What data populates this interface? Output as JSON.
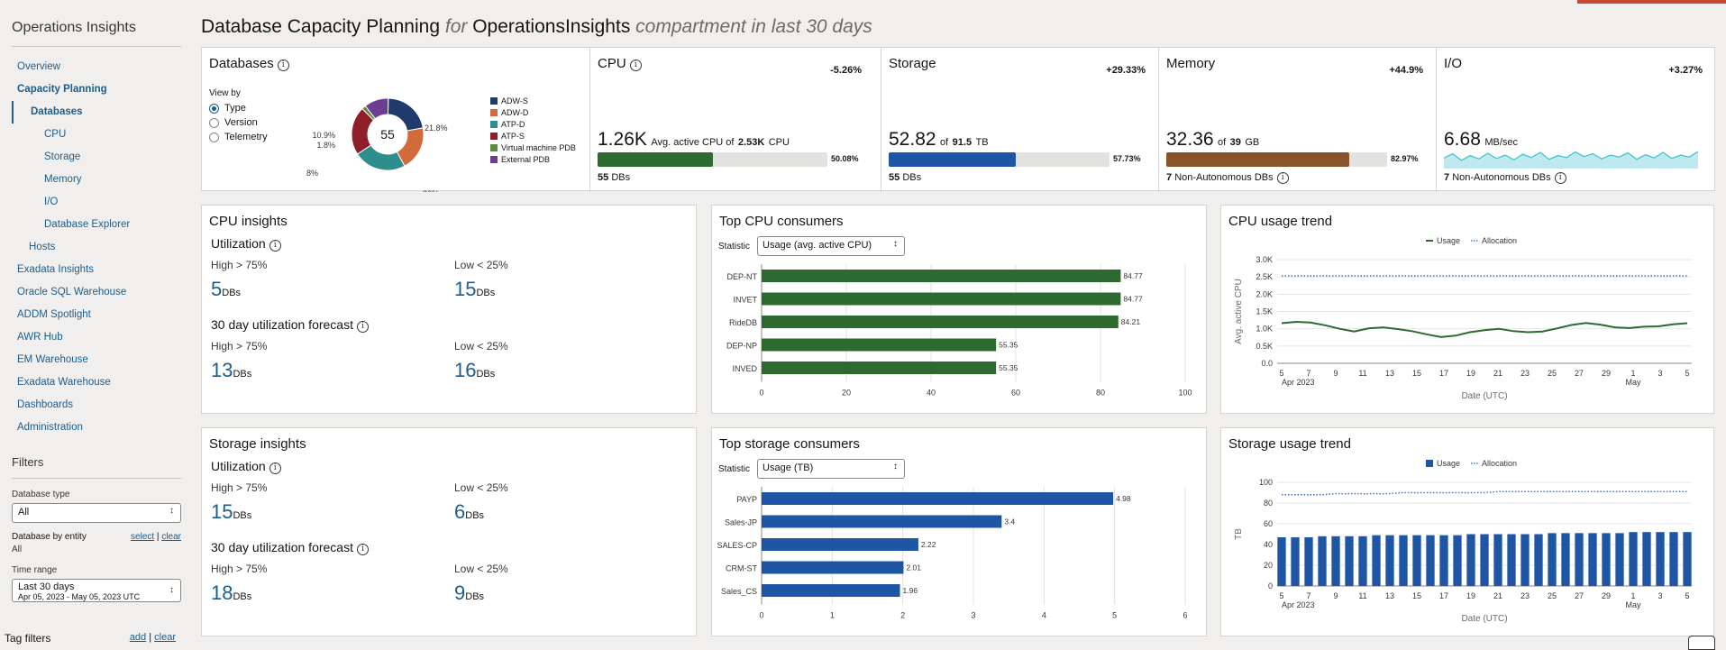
{
  "app_title": "Operations Insights",
  "nav": [
    {
      "label": "Overview",
      "level": 1
    },
    {
      "label": "Capacity Planning",
      "level": 1,
      "bold": true
    },
    {
      "label": "Databases",
      "level": 2,
      "bold": true,
      "selected": true
    },
    {
      "label": "CPU",
      "level": 3
    },
    {
      "label": "Storage",
      "level": 3
    },
    {
      "label": "Memory",
      "level": 3
    },
    {
      "label": "I/O",
      "level": 3
    },
    {
      "label": "Database Explorer",
      "level": 3
    },
    {
      "label": "Hosts",
      "level": 2
    },
    {
      "label": "Exadata Insights",
      "level": 1
    },
    {
      "label": "Oracle SQL Warehouse",
      "level": 1
    },
    {
      "label": "ADDM Spotlight",
      "level": 1
    },
    {
      "label": "AWR Hub",
      "level": 1
    },
    {
      "label": "EM Warehouse",
      "level": 1
    },
    {
      "label": "Exadata Warehouse",
      "level": 1
    },
    {
      "label": "Dashboards",
      "level": 1
    },
    {
      "label": "Administration",
      "level": 1
    }
  ],
  "filters": {
    "title": "Filters",
    "db_type_label": "Database type",
    "db_type_value": "All",
    "entity_label": "Database by entity",
    "entity_select": "select",
    "entity_sep": "|",
    "entity_clear": "clear",
    "entity_value": "All",
    "time_label": "Time range",
    "time_value": "Last 30 days",
    "time_range": "Apr 05, 2023 - May 05, 2023 UTC",
    "tag_label": "Tag filters",
    "tag_add": "add",
    "tag_sep": "|",
    "tag_clear": "clear"
  },
  "page_title": {
    "main": "Database Capacity Planning",
    "for": "for",
    "compartment": "OperationsInsights",
    "suffix": "compartment in last 30 days"
  },
  "databases": {
    "title": "Databases",
    "view_by_label": "View by",
    "view_by_options": [
      "Type",
      "Version",
      "Telemetry"
    ],
    "view_by_selected": "Type",
    "total": "55",
    "slices": [
      {
        "name": "ADW-S",
        "pct": 21.8,
        "label": "21.8%",
        "color": "#1f3a6b"
      },
      {
        "name": "ADW-D",
        "pct": 20.0,
        "label": "20%",
        "color": "#d26b3a"
      },
      {
        "name": "ATP-D",
        "pct": 23.6,
        "label": "23.6%",
        "color": "#2e8d8d"
      },
      {
        "name": "ATP-S",
        "pct": 21.8,
        "label": "21.8%",
        "color": "#8e1f28"
      },
      {
        "name": "Virtual machine PDB",
        "pct": 1.8,
        "label": "1.8%",
        "color": "#5a8a3a"
      },
      {
        "name": "External PDB",
        "pct": 10.9,
        "label": "10.9%",
        "color": "#6d3d91"
      }
    ]
  },
  "metrics": {
    "cpu": {
      "name": "CPU",
      "change": "-5.26%",
      "value": "1.26K",
      "of_text": "Avg. active CPU of",
      "total": "2.53K",
      "unit": "CPU",
      "pct_label": "50.08%",
      "fill": 0.5008,
      "color": "#2d6a2f",
      "foot_num": "55",
      "foot_text": "DBs"
    },
    "storage": {
      "name": "Storage",
      "change": "+29.33%",
      "value": "52.82",
      "of_text": "of",
      "total": "91.5",
      "unit": "TB",
      "pct_label": "57.73%",
      "fill": 0.5773,
      "color": "#1f55a5",
      "foot_num": "55",
      "foot_text": "DBs"
    },
    "memory": {
      "name": "Memory",
      "change": "+44.9%",
      "value": "32.36",
      "of_text": "of",
      "total": "39",
      "unit": "GB",
      "pct_label": "82.97%",
      "fill": 0.8297,
      "color": "#8a5228",
      "foot_num": "7",
      "foot_text": "Non-Autonomous DBs"
    },
    "io": {
      "name": "I/O",
      "change": "+3.27%",
      "value": "6.68",
      "unit": "MB/sec",
      "foot_num": "7",
      "foot_text": "Non-Autonomous DBs"
    }
  },
  "cpu_insights": {
    "title": "CPU insights",
    "util_label": "Utilization",
    "high_label": "High > 75%",
    "low_label": "Low < 25%",
    "util_high": "5",
    "util_low": "15",
    "forecast_label": "30 day utilization forecast",
    "fc_high": "13",
    "fc_low": "16",
    "unit": "DBs"
  },
  "storage_insights": {
    "title": "Storage insights",
    "util_label": "Utilization",
    "high_label": "High > 75%",
    "low_label": "Low < 25%",
    "util_high": "15",
    "util_low": "6",
    "forecast_label": "30 day utilization forecast",
    "fc_high": "18",
    "fc_low": "9",
    "unit": "DBs"
  },
  "top_cpu": {
    "title": "Top CPU consumers",
    "statistic_label": "Statistic",
    "statistic_value": "Usage (avg. active CPU)"
  },
  "top_storage": {
    "title": "Top storage consumers",
    "statistic_label": "Statistic",
    "statistic_value": "Usage (TB)"
  },
  "cpu_trend": {
    "title": "CPU usage trend"
  },
  "storage_trend": {
    "title": "Storage usage trend"
  },
  "chart_data": [
    {
      "type": "pie",
      "categories": [
        "ADW-S",
        "ADW-D",
        "ATP-D",
        "ATP-S",
        "Virtual machine PDB",
        "External PDB"
      ],
      "values": [
        21.8,
        20,
        23.6,
        21.8,
        1.8,
        10.9
      ],
      "center_label": "55"
    },
    {
      "type": "bar",
      "orientation": "horizontal",
      "title": "Top CPU consumers",
      "categories": [
        "DEP-NT",
        "INVET",
        "RideDB",
        "DEP-NP",
        "INVED"
      ],
      "values": [
        84.77,
        84.77,
        84.21,
        55.35,
        55.35
      ],
      "xlim": [
        0,
        100
      ],
      "xticks": [
        0,
        20,
        40,
        60,
        80,
        100
      ],
      "color": "#2d6a2f"
    },
    {
      "type": "bar",
      "orientation": "horizontal",
      "title": "Top storage consumers",
      "categories": [
        "PAYP",
        "Sales-JP",
        "SALES-CP",
        "CRM-ST",
        "Sales_CS"
      ],
      "values": [
        4.98,
        3.4,
        2.22,
        2.01,
        1.96
      ],
      "xlim": [
        0,
        6
      ],
      "xticks": [
        0,
        1,
        2,
        3,
        4,
        5,
        6
      ],
      "color": "#1f55a5"
    },
    {
      "type": "line",
      "title": "CPU usage trend",
      "xlabel": "Date (UTC)",
      "ylabel": "Avg. active CPU",
      "ylim": [
        0,
        3000
      ],
      "yticks": [
        "0.0",
        "0.5K",
        "1.0K",
        "1.5K",
        "2.0K",
        "2.5K",
        "3.0K"
      ],
      "xticks": [
        "5",
        "7",
        "9",
        "11",
        "13",
        "15",
        "17",
        "19",
        "21",
        "23",
        "25",
        "27",
        "29",
        "1",
        "3",
        "5"
      ],
      "xsub": {
        "first": "Apr 2023",
        "may": "May"
      },
      "series": [
        {
          "name": "Usage",
          "style": "solid",
          "color": "#2d6a2f",
          "values": [
            1160,
            1200,
            1180,
            1100,
            1000,
            920,
            1010,
            1040,
            990,
            930,
            840,
            760,
            800,
            900,
            960,
            1000,
            930,
            900,
            920,
            1010,
            1110,
            1170,
            1120,
            1040,
            1020,
            1060,
            1070,
            1130,
            1160
          ]
        },
        {
          "name": "Allocation",
          "style": "dotted",
          "color": "#3b78c4",
          "values": [
            2530,
            2530,
            2530,
            2530,
            2530,
            2530,
            2530,
            2530,
            2530,
            2530,
            2530,
            2530,
            2530,
            2530,
            2530,
            2530,
            2530,
            2530,
            2530,
            2530,
            2530,
            2530,
            2530,
            2530,
            2530,
            2530,
            2530,
            2530,
            2530
          ]
        }
      ]
    },
    {
      "type": "bar",
      "title": "Storage usage trend",
      "xlabel": "Date (UTC)",
      "ylabel": "TB",
      "ylim": [
        0,
        100
      ],
      "yticks": [
        "0",
        "20",
        "40",
        "60",
        "80",
        "100"
      ],
      "xticks": [
        "5",
        "7",
        "9",
        "11",
        "13",
        "15",
        "17",
        "19",
        "21",
        "23",
        "25",
        "27",
        "29",
        "1",
        "3",
        "5"
      ],
      "xsub": {
        "first": "Apr 2023",
        "may": "May"
      },
      "series": [
        {
          "name": "Usage",
          "style": "bar",
          "color": "#1f55a5",
          "values": [
            47,
            47,
            47,
            48,
            48,
            48,
            48,
            49,
            49,
            49,
            49,
            49,
            49,
            49,
            50,
            50,
            50,
            50,
            50,
            50,
            51,
            51,
            51,
            51,
            51,
            51,
            52,
            52,
            52,
            52,
            52
          ]
        },
        {
          "name": "Allocation",
          "style": "dotted",
          "color": "#3b78c4",
          "values": [
            88,
            88,
            88,
            88,
            89,
            89,
            89,
            89,
            89,
            90,
            90,
            90,
            90,
            90,
            90,
            90,
            91,
            91,
            91,
            91,
            91,
            91,
            91,
            91,
            91,
            91,
            91,
            91,
            91,
            91,
            91
          ]
        }
      ]
    },
    {
      "type": "area",
      "title": "I/O sparkline",
      "values": [
        2.1,
        3.0,
        1.6,
        2.6,
        1.9,
        3.1,
        2.0,
        2.7,
        1.7,
        2.9,
        2.2,
        3.3,
        1.8,
        2.6,
        2.2,
        3.4,
        2.4,
        3.0,
        1.9,
        2.7,
        2.3,
        3.2,
        1.8,
        2.8,
        2.1,
        3.3,
        2.0,
        2.7,
        2.3,
        3.5
      ]
    }
  ]
}
